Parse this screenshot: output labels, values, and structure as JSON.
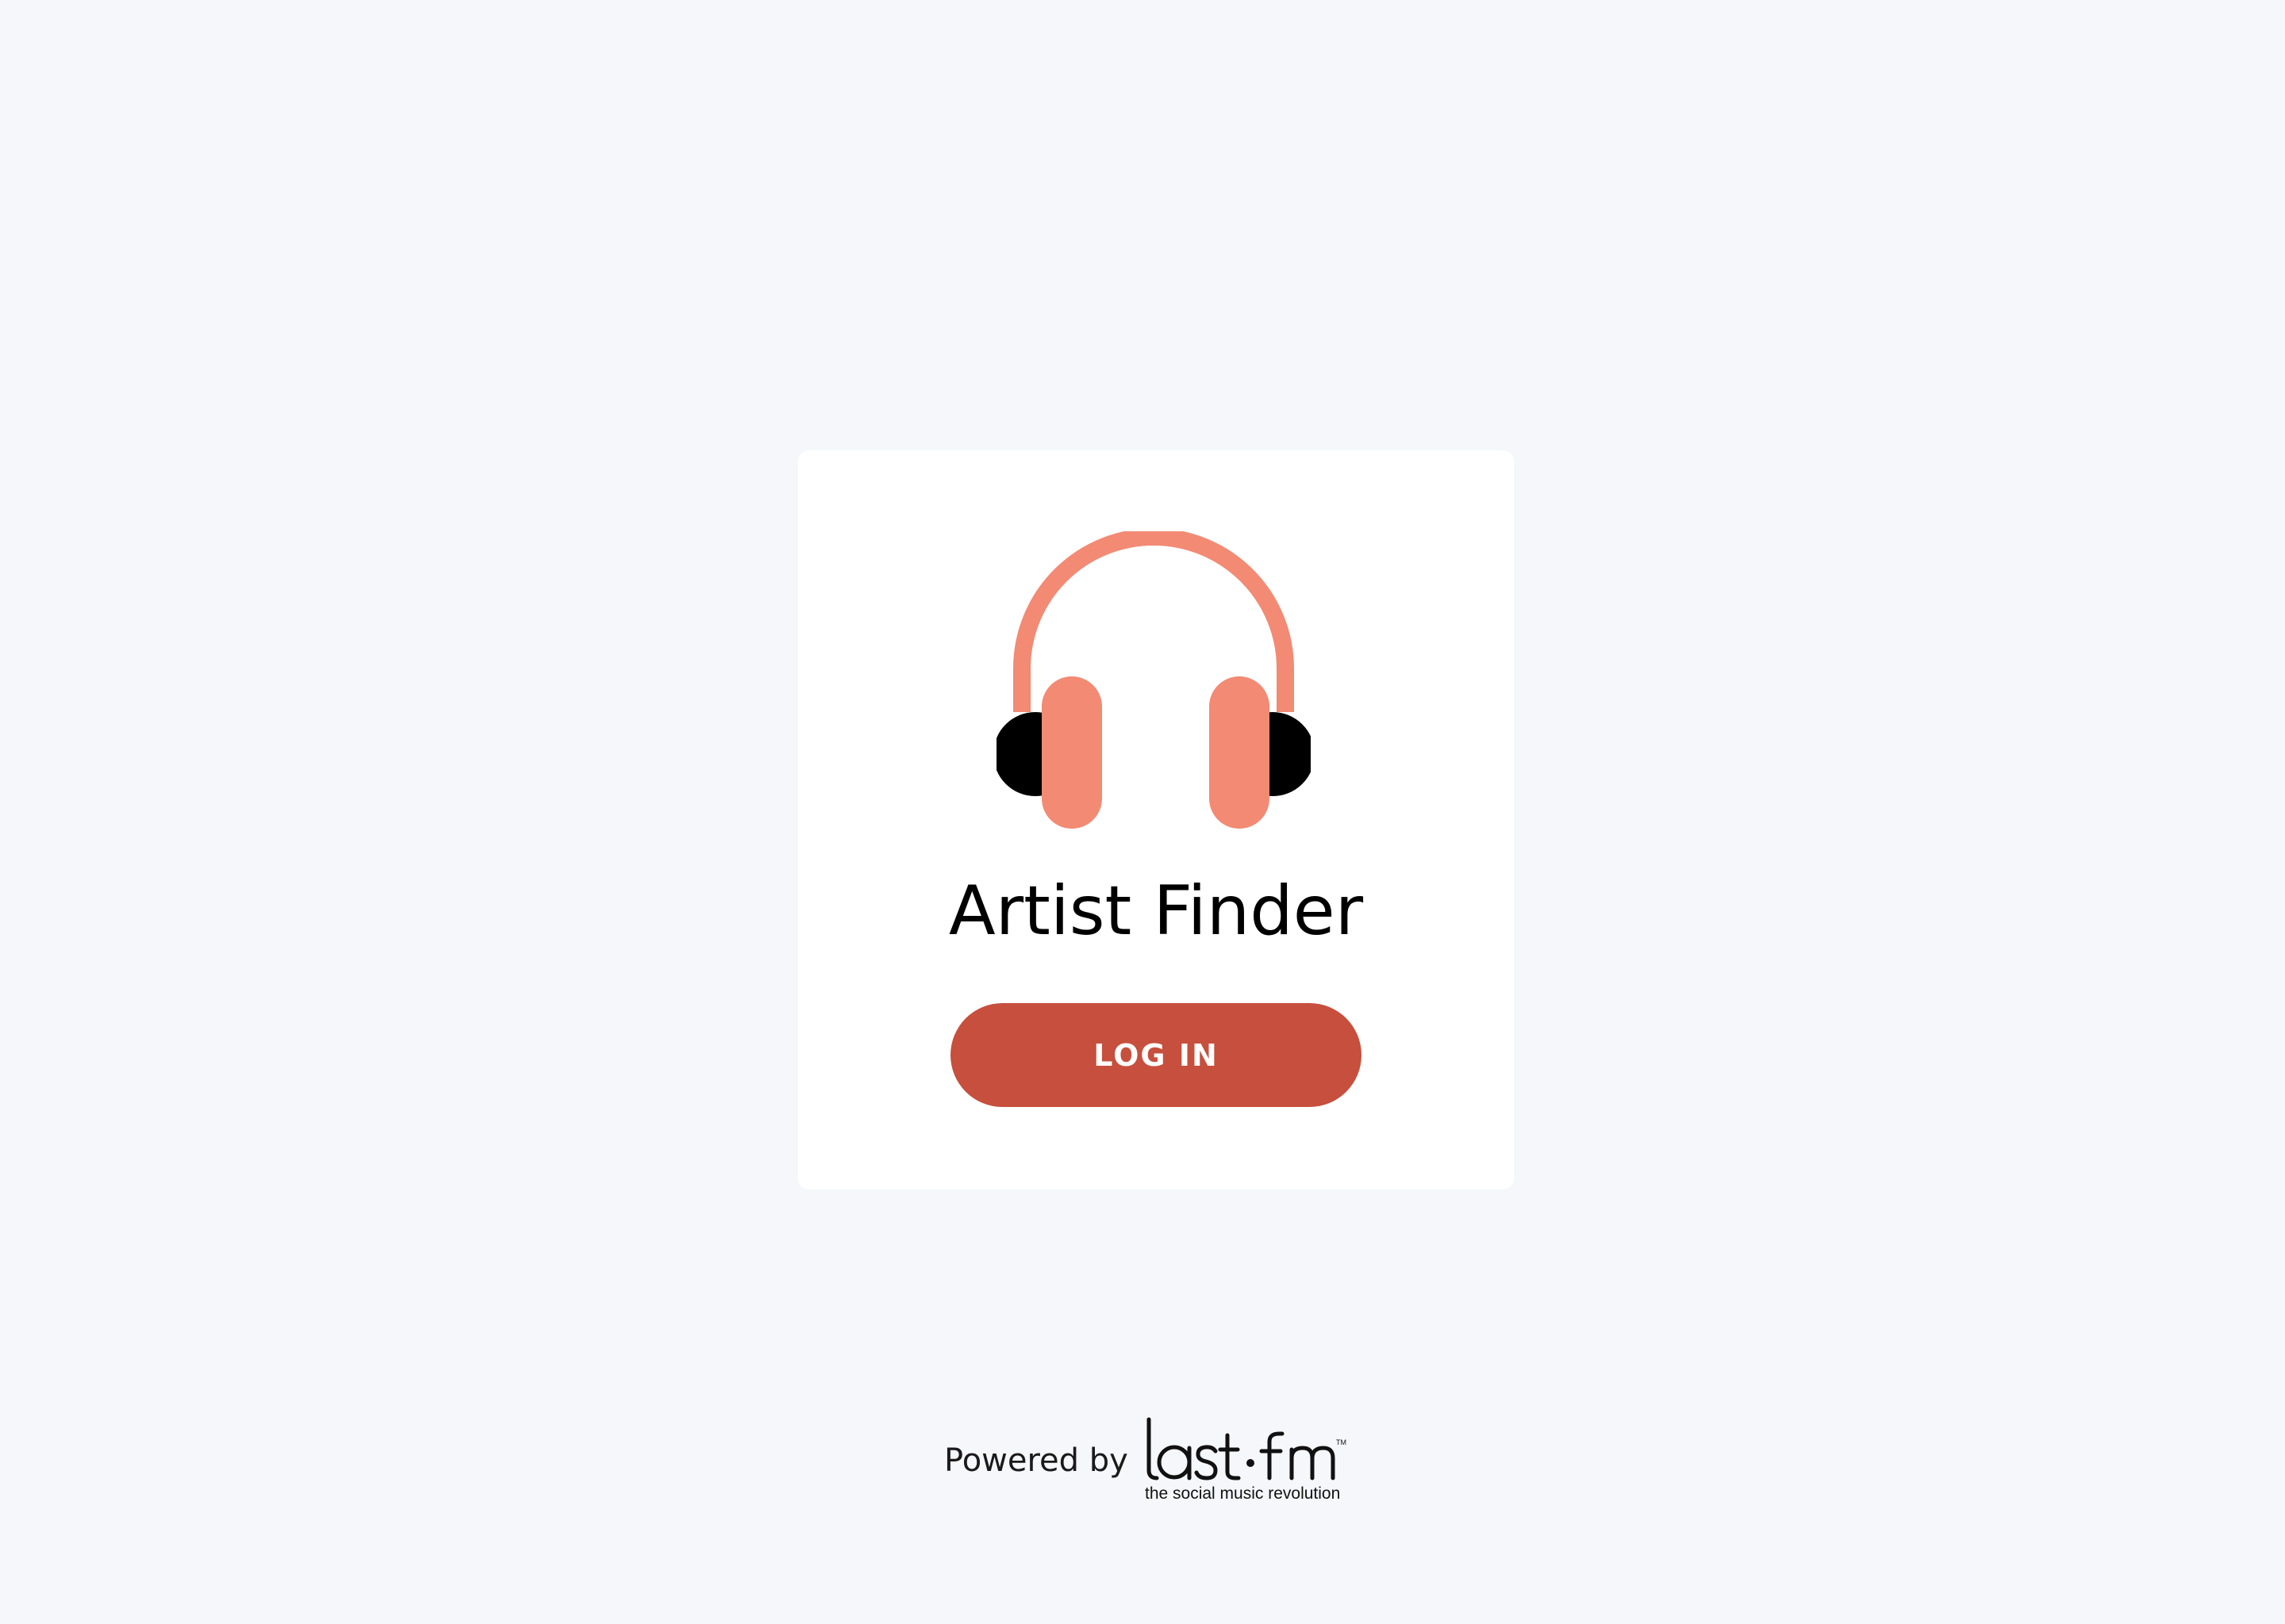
{
  "app": {
    "title": "Artist Finder",
    "icon": "headphones-icon"
  },
  "login": {
    "label": "LOG IN"
  },
  "footer": {
    "powered_by": "Powered by",
    "brand_name": "last.fm",
    "brand_tagline": "the social music revolution"
  },
  "colors": {
    "background": "#f5f7fb",
    "card": "#ffffff",
    "accent_light": "#f28a74",
    "button": "#c74f3d",
    "text": "#000000"
  }
}
